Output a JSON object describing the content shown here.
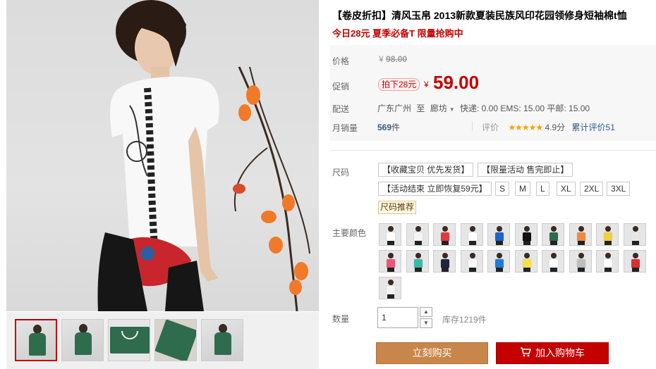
{
  "product": {
    "title": "【卷皮折扣】清风玉帛 2013新款夏装民族风印花园领修身短袖棉t恤",
    "subtitle": "今日28元 夏季必备T 限量抢购中"
  },
  "price_block": {
    "price_label": "价格",
    "original_currency": "¥",
    "original_price": "98.00",
    "promo_label": "促销",
    "promo_tag": "拍下28元",
    "currency": "¥",
    "sale_price": "59.00",
    "shipping_label": "配送",
    "ship_from": "广东广州",
    "ship_to_word": "至",
    "ship_to": "廊坊",
    "shipping_fees": "快递: 0.00 EMS: 15.00 平邮: 15.00",
    "monthly_sales_label": "月销量",
    "monthly_sales": "569",
    "monthly_sales_unit": "件",
    "rating_label": "评价",
    "rating_stars": "★★★★★",
    "rating_score": "4.9分",
    "total_reviews": "累计评价51"
  },
  "sizes": {
    "label": "尺码",
    "options": [
      "【收藏宝贝 优先发货】",
      "【限量活动 售完即止】",
      "【活动结束 立即恢复59元】",
      "S",
      "M",
      "L",
      "XL",
      "2XL",
      "3XL"
    ],
    "size_guide": "尺码推荐"
  },
  "colors": {
    "label": "主要颜色",
    "swatch_tints": [
      "#ffffff",
      "#f5f5f5",
      "#e23a3a",
      "#ffffff",
      "#1f63c9",
      "#111111",
      "#2f6b4d",
      "#f08a3a",
      "#f0d040",
      "#e8e8e8",
      "#e9567a",
      "#3cb9a6",
      "#222244",
      "#fafafa",
      "#1f7bd6",
      "#f2e24a",
      "#ffffff",
      "#bdbdbd",
      "#ffffff",
      "#d93030",
      "#f4f4f4"
    ]
  },
  "quantity": {
    "label": "数量",
    "value": "1",
    "increase_symbol": "▲",
    "decrease_symbol": "▼",
    "stock": "库存1219件"
  },
  "actions": {
    "buy_now": "立刻购买",
    "add_to_cart": "加入购物车"
  },
  "theme": {
    "accent_red": "#c40000",
    "buy_button": "#c8864a",
    "link_blue": "#2d5a8e",
    "star_color": "#f7a200"
  }
}
